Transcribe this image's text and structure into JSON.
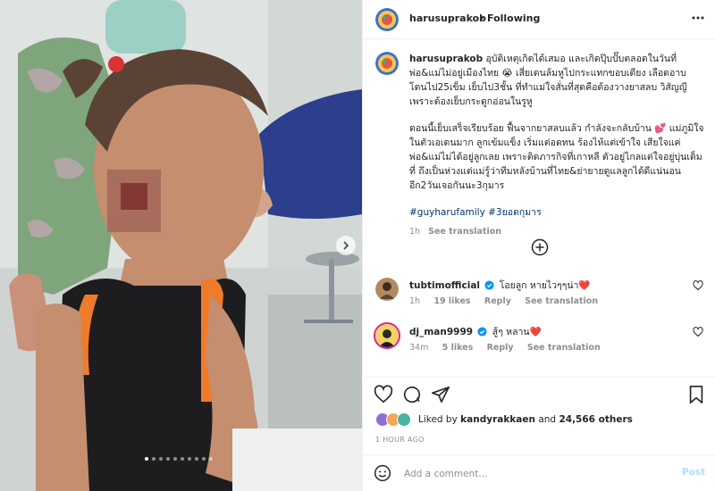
{
  "post": {
    "username": "harusuprakob",
    "follow_status": "Following",
    "caption_p1": "อุบัติเหตุเกิดได้เสมอ และเกิดปุ๊บปั๊บตลอดในวันที่พ่อ&แม่ไม่อยู่เมืองไทย 😭 เสี่ยเดนล้มหูไปกระแทกขอบเตียง เลือดอาบ โดนไป25เข็ม เย็บไป3ชั้น ที่ทำแม่ใจสั่นที่สุดคือต้องวางยาสลบ วิสัญญี เพราะต้องเย็บกระดูกอ่อนในรูหู",
    "caption_p2": "ตอนนี้เย็บเสร็จเรียบร้อย ฟื้นจากยาสลบแล้ว กำลังจะกลับบ้าน 💕 แม่ภูมิใจในตัวเอเดนมาก ลูกเข้มแข็ง เริ่มแต่อดทน ร้องไห้แต่เข้าใจ เสียใจแค่พ่อ&แม่ไม่ได้อยู่ลูกเลย เพราะติดภารกิจที่เกาหลี ตัวอยู่ไกลแต่ใจอยู่บุ่นเต็มที่ ถึงเป็นห่วงแต่แม่รู้ว่าทีมหลังบ้านที่ไทย&ย่ายายดูแลลูกได้ดีแน่นอน อีก2วันเจอกันนะ3กุมาร",
    "hashtags": "#guyharufamily #3ยอดกุมาร",
    "caption_time": "1h",
    "see_translation": "See translation",
    "likes_by_label": "Liked by",
    "likes_by_user": "kandyrakkaen",
    "likes_and": "and",
    "likes_others": "24,566 others",
    "time_ago": "1 HOUR AGO"
  },
  "comments": [
    {
      "username": "tubtimofficial",
      "verified": true,
      "text": "โอยลูก หายไวๆๆน่า❤️",
      "time": "1h",
      "likes": "19 likes",
      "reply": "Reply",
      "see_translation": "See translation"
    },
    {
      "username": "dj_man9999",
      "verified": true,
      "text": "สู้ๆ หลาน❤️",
      "time": "34m",
      "likes": "5 likes",
      "reply": "Reply",
      "see_translation": "See translation"
    }
  ],
  "composer": {
    "placeholder": "Add a comment...",
    "post_label": "Post"
  },
  "carousel": {
    "total": 10,
    "active_index": 0
  },
  "colors": {
    "accent_blue": "#0095f6",
    "link_blue": "#00376b",
    "post_disabled": "#b2dffc",
    "heart_red": "#ed4956",
    "muted": "#8e8e8e"
  },
  "icons": {
    "more": "more-horizontal-icon",
    "like": "heart-outline-icon",
    "comment": "comment-bubble-icon",
    "share": "paper-plane-icon",
    "save": "bookmark-icon",
    "emoji": "smiley-icon",
    "load_more": "plus-circle-icon",
    "carousel_next": "chevron-right-icon",
    "verified": "verified-badge-icon"
  }
}
